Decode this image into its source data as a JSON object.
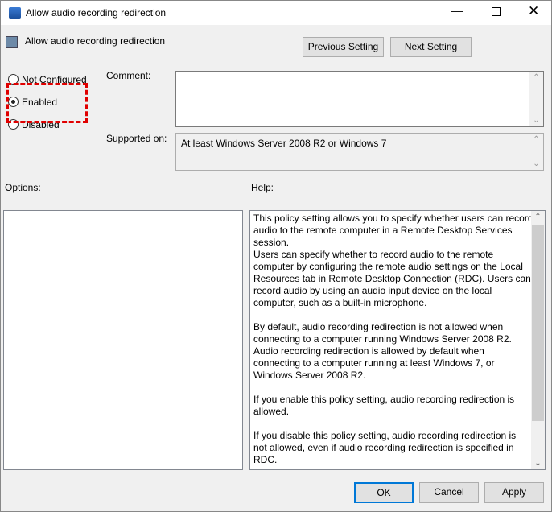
{
  "window": {
    "title": "Allow audio recording redirection"
  },
  "header": {
    "policy_name": "Allow audio recording redirection",
    "previous_label": "Previous Setting",
    "next_label": "Next Setting"
  },
  "state": {
    "options": [
      {
        "label": "Not Configured",
        "selected": false
      },
      {
        "label": "Enabled",
        "selected": true
      },
      {
        "label": "Disabled",
        "selected": false
      }
    ]
  },
  "comment": {
    "label": "Comment:",
    "value": ""
  },
  "supported": {
    "label": "Supported on:",
    "value": "At least Windows Server 2008 R2 or Windows 7"
  },
  "options_label": "Options:",
  "help_label": "Help:",
  "help_lines": [
    "This policy setting allows you to specify whether users can record",
    "audio to the remote computer in a Remote Desktop Services",
    "session.",
    "Users can specify whether to record audio to the remote",
    "computer by configuring the remote audio settings on the Local",
    "Resources tab in Remote Desktop Connection (RDC). Users can",
    "record audio by using an audio input device on the local",
    "computer, such as a built-in microphone.",
    "",
    "By default, audio recording redirection is not allowed when",
    "connecting to a computer running Windows Server 2008 R2.",
    "Audio recording redirection is allowed by default when",
    "connecting to a computer running at least Windows 7, or",
    "Windows Server 2008 R2.",
    "",
    "If you enable this policy setting, audio recording redirection is",
    "allowed.",
    "",
    "If you disable this policy setting, audio recording redirection is",
    "not allowed, even if audio recording redirection is specified in",
    "RDC."
  ],
  "buttons": {
    "ok": "OK",
    "cancel": "Cancel",
    "apply": "Apply"
  },
  "highlight_color": "#e00000"
}
